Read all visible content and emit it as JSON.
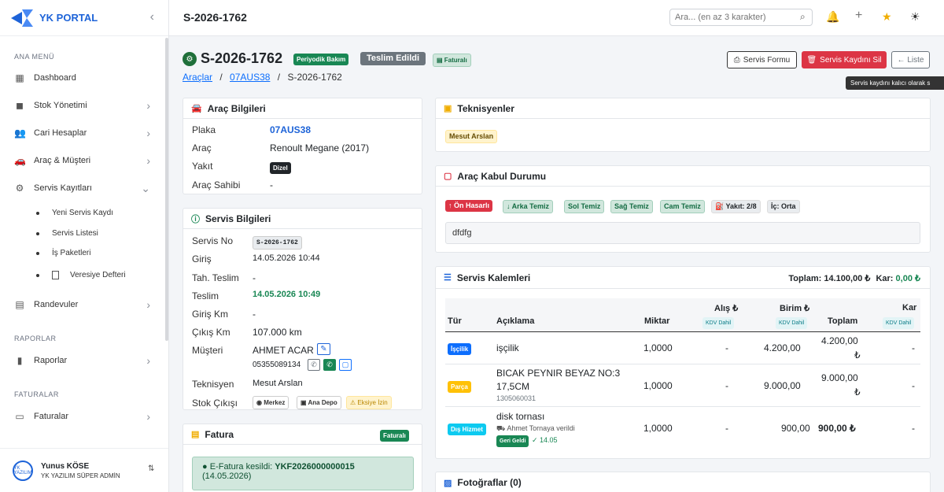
{
  "sidebar": {
    "brand": "YK PORTAL",
    "section_main": "ANA MENÜ",
    "section_reports": "RAPORLAR",
    "section_invoices": "FATURALAR",
    "items": {
      "dashboard": "Dashboard",
      "stock": "Stok Yönetimi",
      "accounts": "Cari Hesaplar",
      "vehicles": "Araç & Müşteri",
      "services": "Servis Kayıtları",
      "appointments": "Randevuler",
      "reports": "Raporlar",
      "invoices": "Faturalar"
    },
    "subitems": {
      "new_service": "Yeni Servis Kaydı",
      "service_list": "Servis Listesi",
      "work_packages": "İş Paketleri",
      "credit_book": "Veresiye Defteri"
    },
    "user": {
      "name": "Yunus KÖSE",
      "role": "YK YAZILIM SÜPER ADMİN",
      "avatar_text": "YK YAZILIM"
    }
  },
  "topbar": {
    "title": "S-2026-1762",
    "search_placeholder": "Ara... (en az 3 karakter)"
  },
  "header": {
    "title": "S-2026-1762",
    "badge_type": "Periyodik Bakım",
    "badge_status": "Teslim Edildi",
    "badge_invoiced": "Faturalı",
    "breadcrumb": {
      "vehicles": "Araçlar",
      "sep": "/",
      "plate": "07AUS38",
      "current": "S-2026-1762"
    },
    "btn_form": "Servis Formu",
    "btn_delete": "Servis Kaydını Sil",
    "btn_list": "← Liste",
    "tooltip": "Servis kaydını kalıcı olarak s"
  },
  "vehicle_info": {
    "title": "Araç Bilgileri",
    "plate_label": "Plaka",
    "plate": "07AUS38",
    "car_label": "Araç",
    "car": "Renoult Megane (2017)",
    "fuel_label": "Yakıt",
    "fuel": "Dizel",
    "owner_label": "Araç Sahibi",
    "owner": "-"
  },
  "service_info": {
    "title": "Servis Bilgileri",
    "no_label": "Servis No",
    "no": "S-2026-1762",
    "entry_label": "Giriş",
    "entry": "14.05.2026 10:44",
    "est_label": "Tah. Teslim",
    "est": "-",
    "delivery_label": "Teslim",
    "delivery": "14.05.2026 10:49",
    "entry_km_label": "Giriş Km",
    "entry_km": "-",
    "exit_km_label": "Çıkış Km",
    "exit_km": "107.000 km",
    "customer_label": "Müşteri",
    "customer": "AHMET ACAR",
    "phone": "05355089134",
    "tech_label": "Teknisyen",
    "tech": "Mesut Arslan",
    "stock_label": "Stok Çıkışı",
    "stock_center": "Merkez",
    "stock_depot": "Ana Depo",
    "stock_missing": "Eksiye İzin"
  },
  "invoice": {
    "title": "Fatura",
    "badge": "Faturalı",
    "text": "E-Fatura kesildi:",
    "number": "YKF2026000000015",
    "date": "(14.05.2026)"
  },
  "technicians": {
    "title": "Teknisyenler",
    "name": "Mesut Arslan"
  },
  "acceptance": {
    "title": "Araç Kabul Durumu",
    "tags": [
      "↑ Ön Hasarlı",
      "↓ Arka Temiz",
      "Sol Temiz",
      "Sağ Temiz",
      "Cam Temiz",
      "Yakıt: 2/8",
      "İç: Orta"
    ],
    "note": "dfdfg"
  },
  "items": {
    "title": "Servis Kalemleri",
    "total_label": "Toplam:",
    "total": "14.100,00 ₺",
    "profit_label": "Kar:",
    "profit": "0,00 ₺",
    "headers": {
      "type": "Tür",
      "desc": "Açıklama",
      "qty": "Miktar",
      "buy": "Alış ₺",
      "unit": "Birim ₺",
      "total": "Toplam",
      "profit": "Kar",
      "kdv": "KDV Dahil"
    },
    "rows": [
      {
        "type": "İşçilik",
        "desc": "işçilik",
        "qty": "1,0000",
        "buy": "-",
        "unit": "4.200,00",
        "total1": "4.200,00",
        "total2": "₺",
        "profit": "-"
      },
      {
        "type": "Parça",
        "desc1": "BICAK PEYNIR BEYAZ NO:3",
        "desc2": "17,5CM",
        "code": "1305060031",
        "qty": "1,0000",
        "buy": "-",
        "unit": "9.000,00",
        "total1": "9.000,00",
        "total2": "₺",
        "profit": "-"
      },
      {
        "type": "Dış Hizmet",
        "desc": "disk tornası",
        "sub": "Ahmet Tornaya verildi",
        "returned": "Geri Geldi",
        "date": "✓ 14.05",
        "qty": "1,0000",
        "buy": "-",
        "unit": "900,00",
        "total": "900,00 ₺",
        "profit": "-"
      }
    ]
  },
  "photos": {
    "title": "Fotoğraflar (0)"
  },
  "colors": {
    "primary": "#1d63d8",
    "success": "#198754",
    "danger": "#dc3545"
  }
}
